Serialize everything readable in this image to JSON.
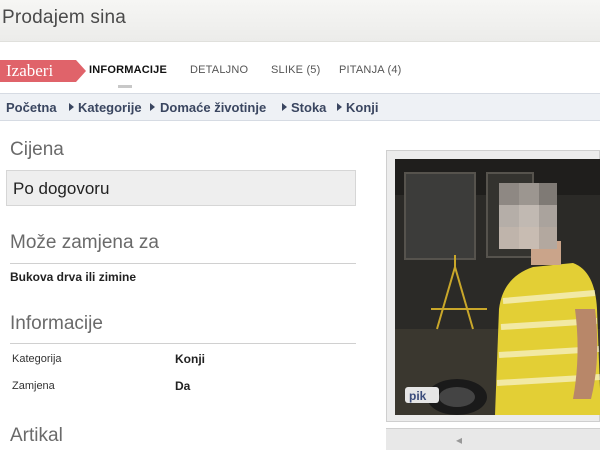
{
  "page": {
    "title": "Prodajem sina"
  },
  "tabs": {
    "brand_label": "Izaberi",
    "items": [
      {
        "label": "INFORMACIJE",
        "active": true
      },
      {
        "label": "DETALJNO",
        "active": false
      },
      {
        "label": "SLIKE (5)",
        "active": false
      },
      {
        "label": "PITANJA (4)",
        "active": false
      }
    ]
  },
  "breadcrumb": [
    "Početna",
    "Kategorije",
    "Domaće životinje",
    "Stoka",
    "Konji"
  ],
  "price": {
    "heading": "Cijena",
    "value": "Po dogovoru"
  },
  "swap": {
    "heading": "Može zamjena za",
    "value": "Bukova drva ili zimine"
  },
  "info": {
    "heading": "Informacije",
    "rows": [
      {
        "label": "Kategorija",
        "value": "Konji"
      },
      {
        "label": "Zamjena",
        "value": "Da"
      }
    ]
  },
  "artikal": {
    "heading": "Artikal"
  },
  "photo": {
    "watermark": "pik"
  },
  "photo_nav": {
    "prev_glyph": "◂"
  },
  "colors": {
    "brand": "#e0636a",
    "breadcrumb_bg": "#eef1f5",
    "link": "#3a4660"
  }
}
